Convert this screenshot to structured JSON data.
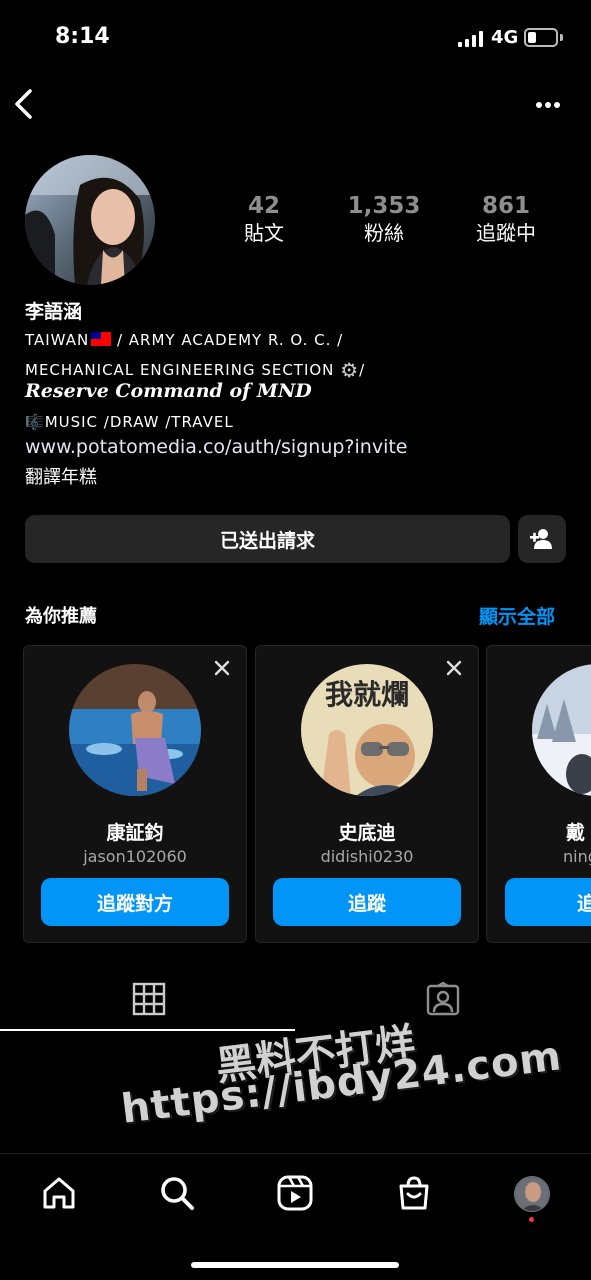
{
  "status": {
    "time": "8:14",
    "network": "4G",
    "battery_percent": 25
  },
  "header": {
    "back_icon": "chevron-left-icon",
    "more_icon": "more-horizontal-icon"
  },
  "profile": {
    "stats": [
      {
        "value": "42",
        "label": "貼文"
      },
      {
        "value": "1,353",
        "label": "粉絲"
      },
      {
        "value": "861",
        "label": "追蹤中"
      }
    ],
    "name": "李語涵",
    "bio": {
      "line1_a": "TAIWAN",
      "line1_b": "/ ARMY ACADEMY R. O. C. /",
      "line2": "MECHANICAL ENGINEERING SECTION",
      "line2_end": "/",
      "line3": "Reserve Command of MND",
      "line4": "MUSIC /DRAW /TRAVEL"
    },
    "link": "www.potatomedia.co/auth/signup?invite",
    "translate": "翻譯年糕"
  },
  "actions": {
    "request_sent": "已送出請求"
  },
  "suggestions": {
    "title": "為你推薦",
    "see_all": "顯示全部",
    "cards": [
      {
        "name": "康証鈞",
        "handle": "jason102060",
        "button": "追蹤對方"
      },
      {
        "name": "史底迪",
        "handle": "didishi0230",
        "button": "追蹤",
        "sticker_text": "我就爛"
      },
      {
        "name": "戴",
        "handle": "ning",
        "button": "追"
      }
    ]
  },
  "tabs": [
    {
      "icon": "grid-icon",
      "active": true
    },
    {
      "icon": "tagged-person-icon",
      "active": false
    }
  ],
  "watermark": {
    "line1": "黑料不打烊",
    "line2": "https://ibdy24.com"
  },
  "bottom_nav": [
    "home-icon",
    "search-icon",
    "reels-icon",
    "shop-icon",
    "profile-avatar"
  ],
  "colors": {
    "accent": "#0095f6",
    "surface": "#262626",
    "card": "#121212",
    "muted": "#8e8e8e"
  }
}
